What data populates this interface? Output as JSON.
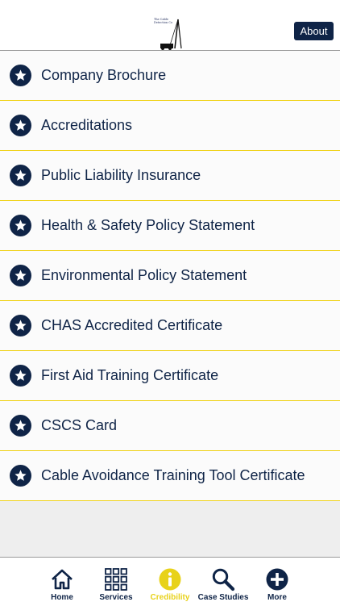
{
  "header": {
    "logo_text": "The Cable Detection Co",
    "about_label": "About"
  },
  "list": {
    "items": [
      {
        "label": "Company Brochure",
        "icon": "star-icon"
      },
      {
        "label": "Accreditations",
        "icon": "star-icon"
      },
      {
        "label": "Public Liability Insurance",
        "icon": "star-icon"
      },
      {
        "label": "Health & Safety Policy Statement",
        "icon": "star-icon"
      },
      {
        "label": "Environmental Policy Statement",
        "icon": "star-icon"
      },
      {
        "label": "CHAS Accredited Certificate",
        "icon": "star-icon"
      },
      {
        "label": "First Aid Training Certificate",
        "icon": "star-icon"
      },
      {
        "label": "CSCS Card",
        "icon": "star-icon"
      },
      {
        "label": "Cable Avoidance Training Tool Certificate",
        "icon": "star-icon"
      }
    ]
  },
  "tabbar": {
    "tabs": [
      {
        "label": "Home",
        "icon": "home-icon"
      },
      {
        "label": "Services",
        "icon": "grid-icon"
      },
      {
        "label": "Credibility",
        "icon": "info-icon",
        "active": true
      },
      {
        "label": "Case Studies",
        "icon": "search-icon"
      },
      {
        "label": "More",
        "icon": "plus-icon"
      }
    ]
  },
  "colors": {
    "navy": "#0f2447",
    "accent_yellow": "#e8d21a",
    "row_divider": "#f0d31c"
  }
}
